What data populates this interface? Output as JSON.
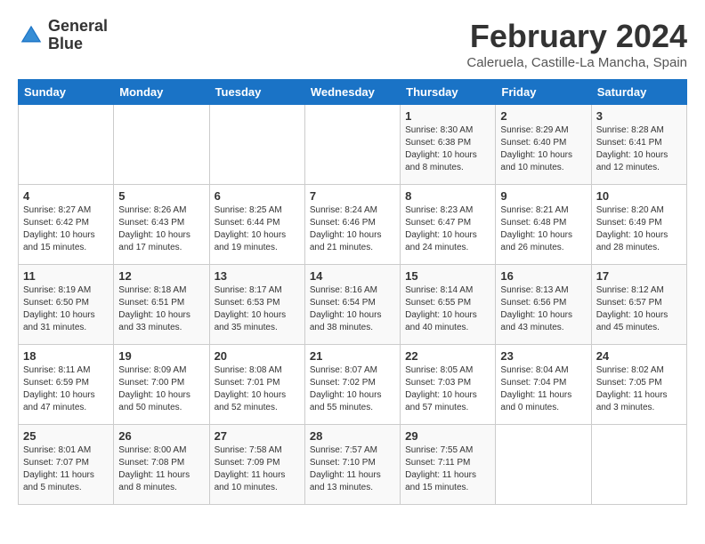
{
  "header": {
    "logo_line1": "General",
    "logo_line2": "Blue",
    "month": "February 2024",
    "location": "Caleruela, Castille-La Mancha, Spain"
  },
  "days_of_week": [
    "Sunday",
    "Monday",
    "Tuesday",
    "Wednesday",
    "Thursday",
    "Friday",
    "Saturday"
  ],
  "weeks": [
    [
      {
        "day": "",
        "info": ""
      },
      {
        "day": "",
        "info": ""
      },
      {
        "day": "",
        "info": ""
      },
      {
        "day": "",
        "info": ""
      },
      {
        "day": "1",
        "info": "Sunrise: 8:30 AM\nSunset: 6:38 PM\nDaylight: 10 hours\nand 8 minutes."
      },
      {
        "day": "2",
        "info": "Sunrise: 8:29 AM\nSunset: 6:40 PM\nDaylight: 10 hours\nand 10 minutes."
      },
      {
        "day": "3",
        "info": "Sunrise: 8:28 AM\nSunset: 6:41 PM\nDaylight: 10 hours\nand 12 minutes."
      }
    ],
    [
      {
        "day": "4",
        "info": "Sunrise: 8:27 AM\nSunset: 6:42 PM\nDaylight: 10 hours\nand 15 minutes."
      },
      {
        "day": "5",
        "info": "Sunrise: 8:26 AM\nSunset: 6:43 PM\nDaylight: 10 hours\nand 17 minutes."
      },
      {
        "day": "6",
        "info": "Sunrise: 8:25 AM\nSunset: 6:44 PM\nDaylight: 10 hours\nand 19 minutes."
      },
      {
        "day": "7",
        "info": "Sunrise: 8:24 AM\nSunset: 6:46 PM\nDaylight: 10 hours\nand 21 minutes."
      },
      {
        "day": "8",
        "info": "Sunrise: 8:23 AM\nSunset: 6:47 PM\nDaylight: 10 hours\nand 24 minutes."
      },
      {
        "day": "9",
        "info": "Sunrise: 8:21 AM\nSunset: 6:48 PM\nDaylight: 10 hours\nand 26 minutes."
      },
      {
        "day": "10",
        "info": "Sunrise: 8:20 AM\nSunset: 6:49 PM\nDaylight: 10 hours\nand 28 minutes."
      }
    ],
    [
      {
        "day": "11",
        "info": "Sunrise: 8:19 AM\nSunset: 6:50 PM\nDaylight: 10 hours\nand 31 minutes."
      },
      {
        "day": "12",
        "info": "Sunrise: 8:18 AM\nSunset: 6:51 PM\nDaylight: 10 hours\nand 33 minutes."
      },
      {
        "day": "13",
        "info": "Sunrise: 8:17 AM\nSunset: 6:53 PM\nDaylight: 10 hours\nand 35 minutes."
      },
      {
        "day": "14",
        "info": "Sunrise: 8:16 AM\nSunset: 6:54 PM\nDaylight: 10 hours\nand 38 minutes."
      },
      {
        "day": "15",
        "info": "Sunrise: 8:14 AM\nSunset: 6:55 PM\nDaylight: 10 hours\nand 40 minutes."
      },
      {
        "day": "16",
        "info": "Sunrise: 8:13 AM\nSunset: 6:56 PM\nDaylight: 10 hours\nand 43 minutes."
      },
      {
        "day": "17",
        "info": "Sunrise: 8:12 AM\nSunset: 6:57 PM\nDaylight: 10 hours\nand 45 minutes."
      }
    ],
    [
      {
        "day": "18",
        "info": "Sunrise: 8:11 AM\nSunset: 6:59 PM\nDaylight: 10 hours\nand 47 minutes."
      },
      {
        "day": "19",
        "info": "Sunrise: 8:09 AM\nSunset: 7:00 PM\nDaylight: 10 hours\nand 50 minutes."
      },
      {
        "day": "20",
        "info": "Sunrise: 8:08 AM\nSunset: 7:01 PM\nDaylight: 10 hours\nand 52 minutes."
      },
      {
        "day": "21",
        "info": "Sunrise: 8:07 AM\nSunset: 7:02 PM\nDaylight: 10 hours\nand 55 minutes."
      },
      {
        "day": "22",
        "info": "Sunrise: 8:05 AM\nSunset: 7:03 PM\nDaylight: 10 hours\nand 57 minutes."
      },
      {
        "day": "23",
        "info": "Sunrise: 8:04 AM\nSunset: 7:04 PM\nDaylight: 11 hours\nand 0 minutes."
      },
      {
        "day": "24",
        "info": "Sunrise: 8:02 AM\nSunset: 7:05 PM\nDaylight: 11 hours\nand 3 minutes."
      }
    ],
    [
      {
        "day": "25",
        "info": "Sunrise: 8:01 AM\nSunset: 7:07 PM\nDaylight: 11 hours\nand 5 minutes."
      },
      {
        "day": "26",
        "info": "Sunrise: 8:00 AM\nSunset: 7:08 PM\nDaylight: 11 hours\nand 8 minutes."
      },
      {
        "day": "27",
        "info": "Sunrise: 7:58 AM\nSunset: 7:09 PM\nDaylight: 11 hours\nand 10 minutes."
      },
      {
        "day": "28",
        "info": "Sunrise: 7:57 AM\nSunset: 7:10 PM\nDaylight: 11 hours\nand 13 minutes."
      },
      {
        "day": "29",
        "info": "Sunrise: 7:55 AM\nSunset: 7:11 PM\nDaylight: 11 hours\nand 15 minutes."
      },
      {
        "day": "",
        "info": ""
      },
      {
        "day": "",
        "info": ""
      }
    ]
  ]
}
